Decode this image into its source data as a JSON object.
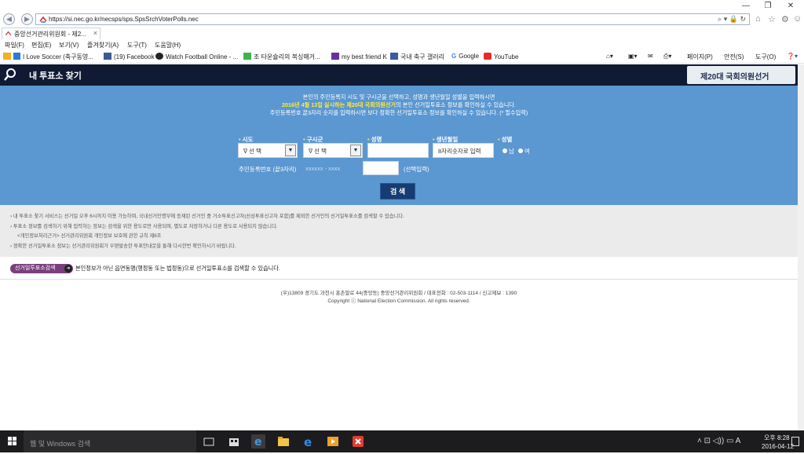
{
  "browser": {
    "url": "https://si.nec.go.kr/necsps/sps.SpsSrchVoterPolls.nec",
    "tab_title": "중앙선거관리위원회 - 제2...",
    "tab_close": "×",
    "window_controls": [
      "—",
      "❐",
      "✕"
    ],
    "menu": [
      "파일(F)",
      "편집(E)",
      "보기(V)",
      "즐겨찾기(A)",
      "도구(T)",
      "도움말(H)"
    ],
    "favorites": [
      "I Love Soccer (축구동영...",
      "(19) Facebook",
      "Watch Football Online - ...",
      "조 타운슐리의 복싱매거...",
      "my best friend K",
      "국내 축구 갤러리",
      "Google",
      "YouTube"
    ],
    "commands": [
      "페이지(P)",
      "안전(S)",
      "도구(O)"
    ]
  },
  "header": {
    "title": "내 투표소 찾기",
    "election": "제20대 국회의원선거"
  },
  "form": {
    "instruction_line1": "본인의 주민등록지 시도 및 구시군을 선택하고, 성명과 생년월일 성별을 입력하시면",
    "instruction_line2_highlight": "2016년 4월 13일 실시하는 제20대 국회의원선거",
    "instruction_line2_rest": "의 본인 선거일투표소 정보를 확인하실 수 있습니다.",
    "instruction_line3": "주민등록번호 끝3자리 숫자를 입력하시면 보다 정확한 선거일투표소 정보를 확인하실 수 있습니다. (* 필수입력)",
    "label_sido": "시도",
    "label_gusigun": "구시군",
    "label_name": "성명",
    "label_birth": "생년월일",
    "label_gender": "성별",
    "sido_value": "∇ 선 택",
    "gusigun_value": "∇ 선 택",
    "name_value": "",
    "birth_placeholder": "8자리숫자로 입력",
    "gender_male": "남",
    "gender_female": "여",
    "rrn_label": "주민등록번호 (끝3자리)",
    "rrn_mask": "xxxxxx - xxxx",
    "rrn_optional": "(선택입력)",
    "search_button": "검 색"
  },
  "notices": [
    "› 내 투표소 찾기 서비스는 선거일 오후 6시까지 이용 가능하며, 국내선거인명부에 등재된 선거인 중 거소투표신고자(선상투표신고자 포함)를 제외한 선거인의 선거일투표소를 검색할 수 있습니다.",
    "› 투표소 정보를 검색하기 위해 입력하는 정보는 검색을 위한 용도로만 사용되며, 별도로 저장하거나 다른 용도로 사용되지 않습니다.",
    "<개인정보처리근거> 선거관리위원회 개인정보 보호에 관한 규칙 제6조",
    "› 정확한 선거일투표소 정보는 선거관리위원회가 우편발송한 투표안내문을 통해 다시한번 확인하시기 바랍니다."
  ],
  "poll_search": {
    "button": "선거일투표소검색",
    "text": "본인정보가 아닌 읍면동명(행정동 또는 법정동)으로 선거일투표소를 검색할 수 있습니다."
  },
  "footer": {
    "address": "(우)13809 경기도 과천시 홍촌말로 44(중앙동) 중앙선거관리위원회 / 대표전화 : 02-503-1114 / 신고제보 : 1390",
    "copyright": "Copyright ⓒ National Election Commission. All rights reserved."
  },
  "taskbar": {
    "search_placeholder": "웹 및 Windows 검색",
    "time": "오후 8:28",
    "date": "2016-04-12"
  },
  "colors": {
    "panel_blue": "#5b97d0",
    "header_navy": "#101a33",
    "highlight_yellow": "#ffea3d",
    "button_navy": "#163c72",
    "poll_button_purple": "#7a3e7d"
  }
}
